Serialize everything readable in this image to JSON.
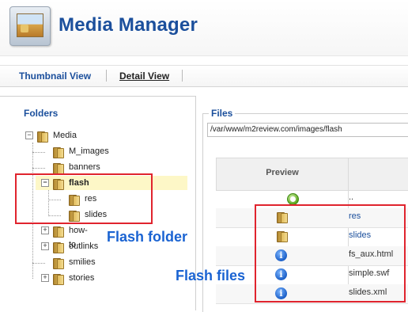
{
  "header": {
    "title": "Media Manager",
    "logo_icon": "media-manager-logo"
  },
  "tabs": [
    {
      "label": "Thumbnail View"
    },
    {
      "label": "Detail View"
    }
  ],
  "folders": {
    "title": "Folders",
    "tree": [
      {
        "label": "Media",
        "toggle": "−",
        "level": 0
      },
      {
        "label": "M_images",
        "level": 1
      },
      {
        "label": "banners",
        "level": 1
      },
      {
        "label": "flash",
        "toggle": "−",
        "level": 1,
        "selected": true
      },
      {
        "label": "res",
        "level": 2
      },
      {
        "label": "slides",
        "level": 2
      },
      {
        "label": "how-to",
        "toggle": "+",
        "level": 1
      },
      {
        "label": "outlinks",
        "toggle": "+",
        "level": 1
      },
      {
        "label": "smilies",
        "level": 1
      },
      {
        "label": "stories",
        "toggle": "+",
        "level": 1
      }
    ]
  },
  "files": {
    "title": "Files",
    "path": "/var/www/m2review.com/images/flash",
    "columns": [
      "Preview"
    ],
    "rows": [
      {
        "name": "..",
        "icon": "up-folder-icon",
        "type": "parent"
      },
      {
        "name": "res",
        "icon": "folder-icon",
        "type": "folder"
      },
      {
        "name": "slides",
        "icon": "folder-icon",
        "type": "folder"
      },
      {
        "name": "fs_aux.html",
        "icon": "info-icon",
        "type": "file"
      },
      {
        "name": "simple.swf",
        "icon": "info-icon",
        "type": "file"
      },
      {
        "name": "slides.xml",
        "icon": "info-icon",
        "type": "file"
      }
    ]
  },
  "annotations": {
    "flash_folder": "Flash folder",
    "flash_files": "Flash files",
    "color": "#e0242e",
    "label_color": "#1a63d2"
  }
}
